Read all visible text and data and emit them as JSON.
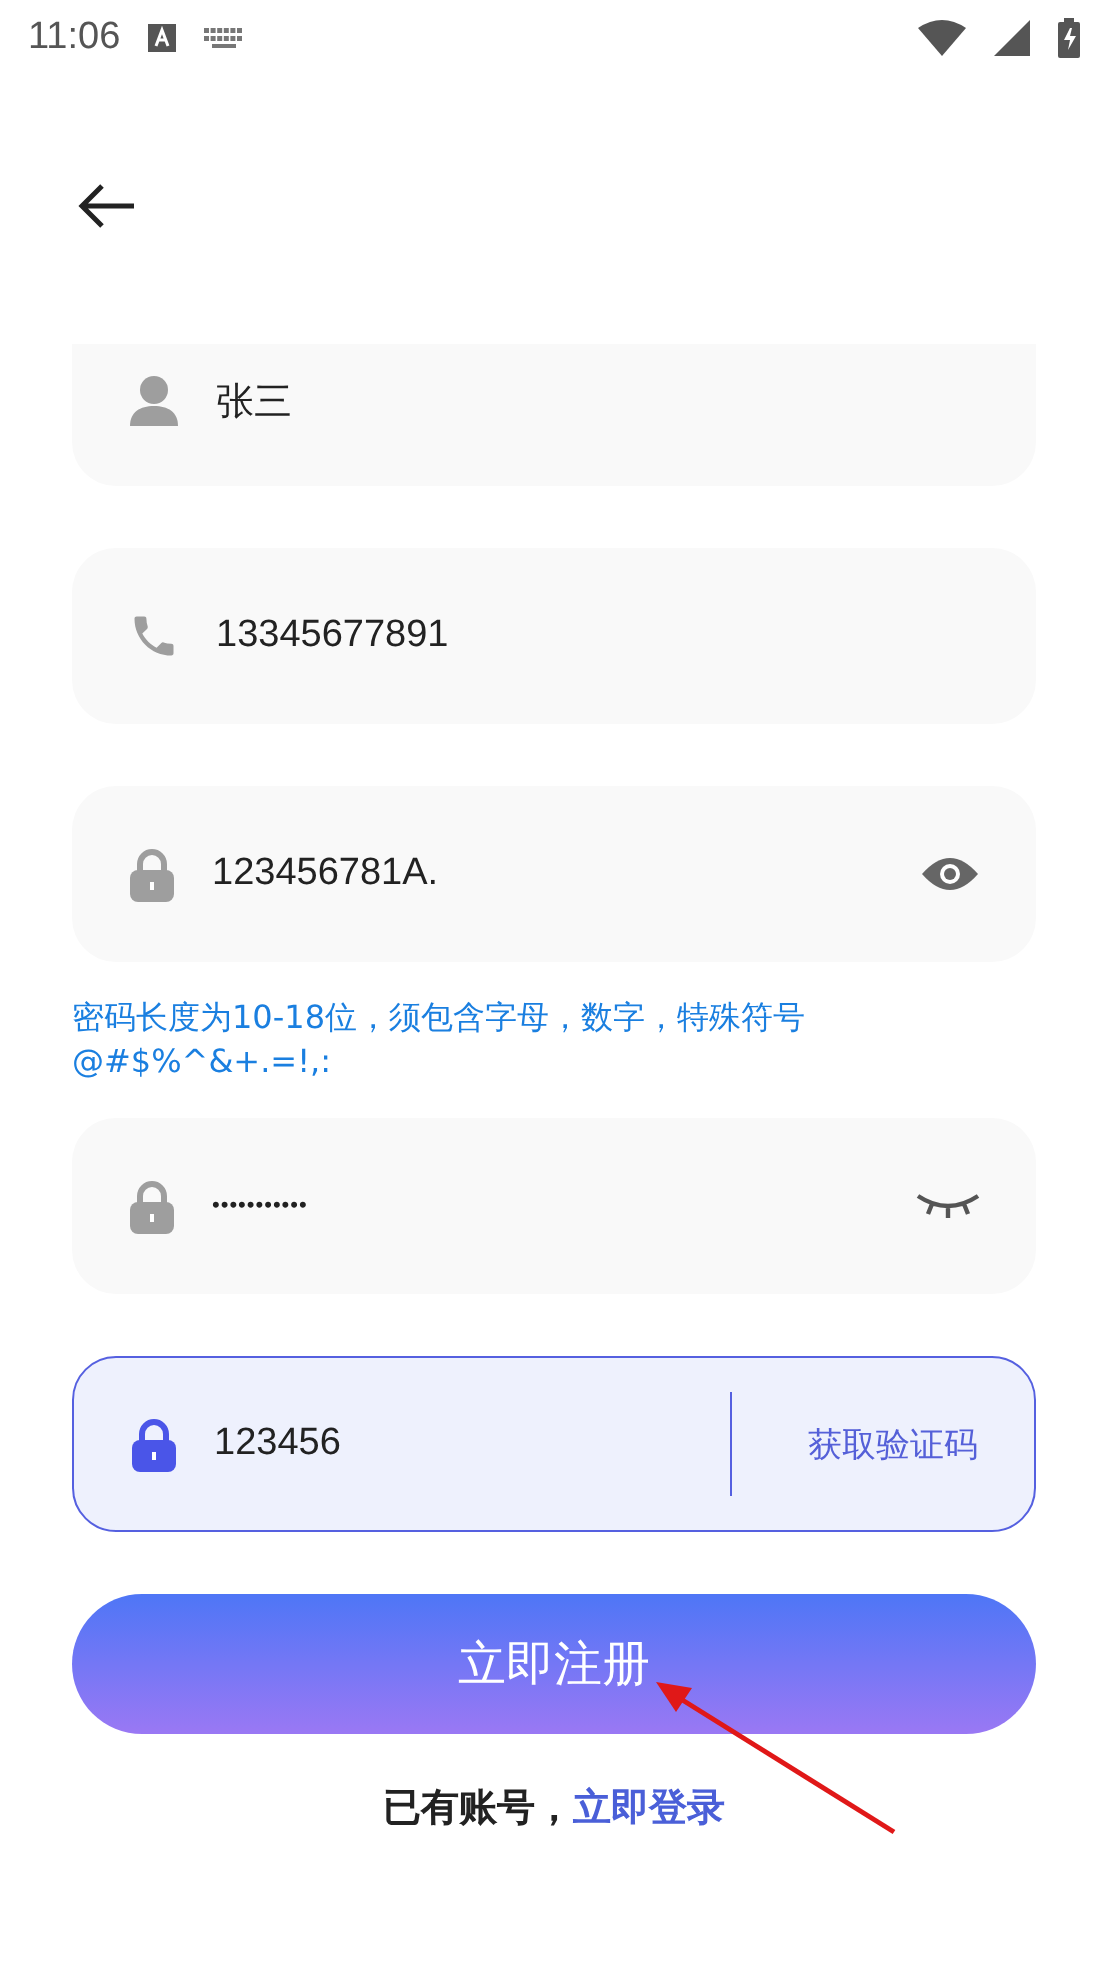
{
  "status_bar": {
    "time": "11:06"
  },
  "fields": [
    {
      "kind": "person",
      "value": "张三",
      "masked": false,
      "focused": false
    },
    {
      "kind": "phone",
      "value": "13345677891",
      "masked": false,
      "focused": false
    },
    {
      "kind": "password",
      "value": "123456781A.",
      "masked": false,
      "focused": false
    },
    {
      "kind": "password",
      "value": "•••••••••••",
      "masked": true,
      "focused": false
    },
    {
      "kind": "code",
      "value": "123456",
      "masked": false,
      "focused": true,
      "action": "获取验证码"
    }
  ],
  "password_hint": "密码长度为10-18位，须包含字母，数字，特殊符号@#$%^&+.=!,:",
  "register_button": "立即注册",
  "login_prompt": {
    "text": "已有账号，",
    "link": "立即登录"
  }
}
